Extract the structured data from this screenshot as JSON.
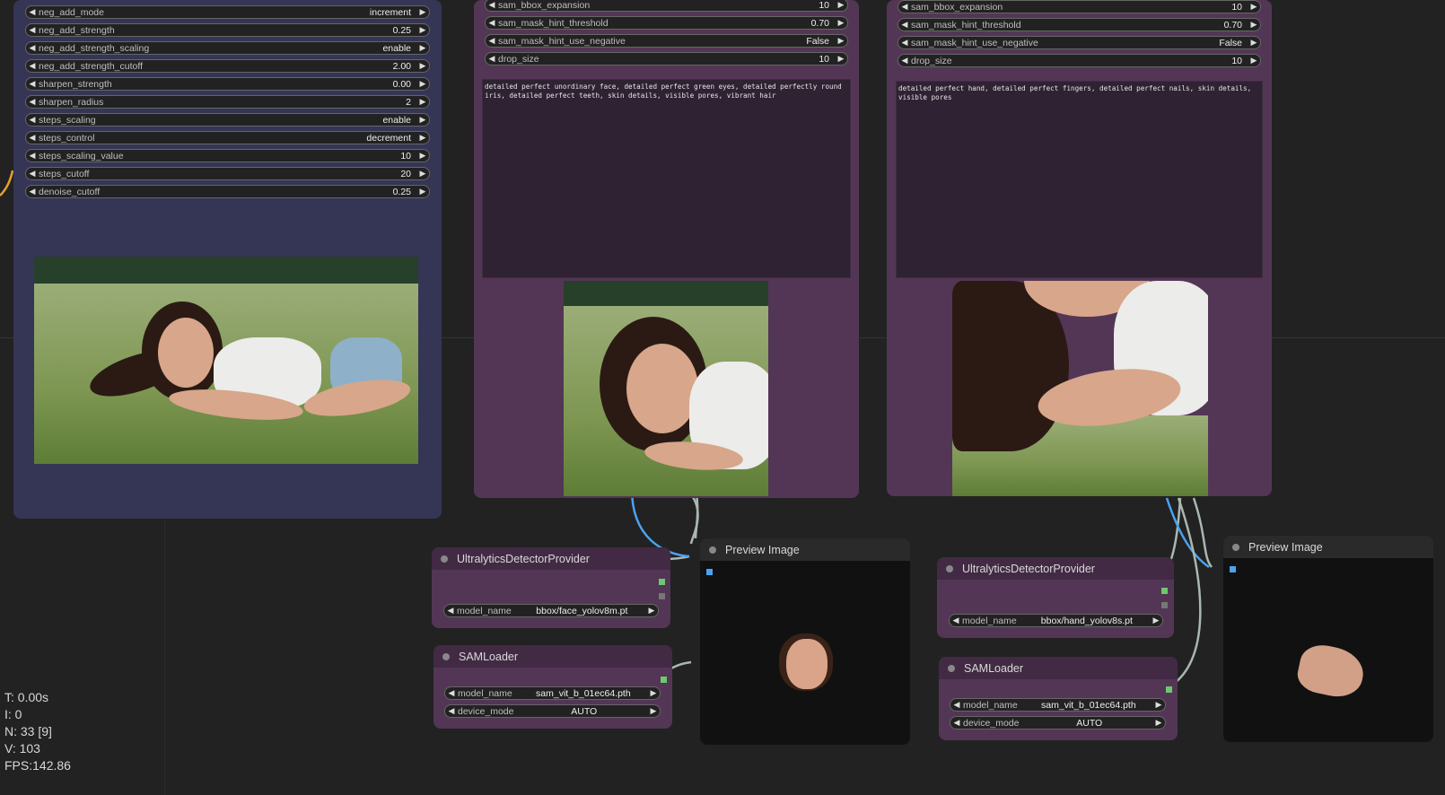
{
  "left_node": {
    "widgets": [
      {
        "label": "neg_add_mode",
        "value": "increment"
      },
      {
        "label": "neg_add_strength",
        "value": "0.25"
      },
      {
        "label": "neg_add_strength_scaling",
        "value": "enable"
      },
      {
        "label": "neg_add_strength_cutoff",
        "value": "2.00"
      },
      {
        "label": "sharpen_strength",
        "value": "0.00"
      },
      {
        "label": "sharpen_radius",
        "value": "2"
      },
      {
        "label": "steps_scaling",
        "value": "enable"
      },
      {
        "label": "steps_control",
        "value": "decrement"
      },
      {
        "label": "steps_scaling_value",
        "value": "10"
      },
      {
        "label": "steps_cutoff",
        "value": "20"
      },
      {
        "label": "denoise_cutoff",
        "value": "0.25"
      }
    ]
  },
  "face_detailer": {
    "widgets": [
      {
        "label": "sam_bbox_expansion",
        "value": "10"
      },
      {
        "label": "sam_mask_hint_threshold",
        "value": "0.70"
      },
      {
        "label": "sam_mask_hint_use_negative",
        "value": "False"
      },
      {
        "label": "drop_size",
        "value": "10"
      }
    ],
    "prompt": "detailed perfect unordinary face, detailed perfect green eyes, detailed perfectly round iris, detailed perfect teeth, skin details, visible pores, vibrant hair"
  },
  "hand_detailer": {
    "widgets": [
      {
        "label": "sam_bbox_expansion",
        "value": "10"
      },
      {
        "label": "sam_mask_hint_threshold",
        "value": "0.70"
      },
      {
        "label": "sam_mask_hint_use_negative",
        "value": "False"
      },
      {
        "label": "drop_size",
        "value": "10"
      }
    ],
    "prompt": "detailed perfect hand, detailed perfect fingers, detailed perfect nails, skin details, visible pores"
  },
  "detector_face": {
    "title": "UltralyticsDetectorProvider",
    "widget": {
      "label": "model_name",
      "value": "bbox/face_yolov8m.pt"
    }
  },
  "detector_hand": {
    "title": "UltralyticsDetectorProvider",
    "widget": {
      "label": "model_name",
      "value": "bbox/hand_yolov8s.pt"
    }
  },
  "sam_face": {
    "title": "SAMLoader",
    "widgets": [
      {
        "label": "model_name",
        "value": "sam_vit_b_01ec64.pth"
      },
      {
        "label": "device_mode",
        "value": "AUTO"
      }
    ]
  },
  "sam_hand": {
    "title": "SAMLoader",
    "widgets": [
      {
        "label": "model_name",
        "value": "sam_vit_b_01ec64.pth"
      },
      {
        "label": "device_mode",
        "value": "AUTO"
      }
    ]
  },
  "preview_face": {
    "title": "Preview Image"
  },
  "preview_hand": {
    "title": "Preview Image"
  },
  "stats": {
    "t": "T: 0.00s",
    "i": "I: 0",
    "n": "N: 33 [9]",
    "v": "V: 103",
    "fps": "FPS:142.86"
  },
  "colors": {
    "canvas": "#222222",
    "node_blue": "#353556",
    "node_purple": "#533655",
    "link_blue": "#4aa3f0",
    "link_grey": "#a9b8b0",
    "slot_green": "#6ec86e"
  }
}
